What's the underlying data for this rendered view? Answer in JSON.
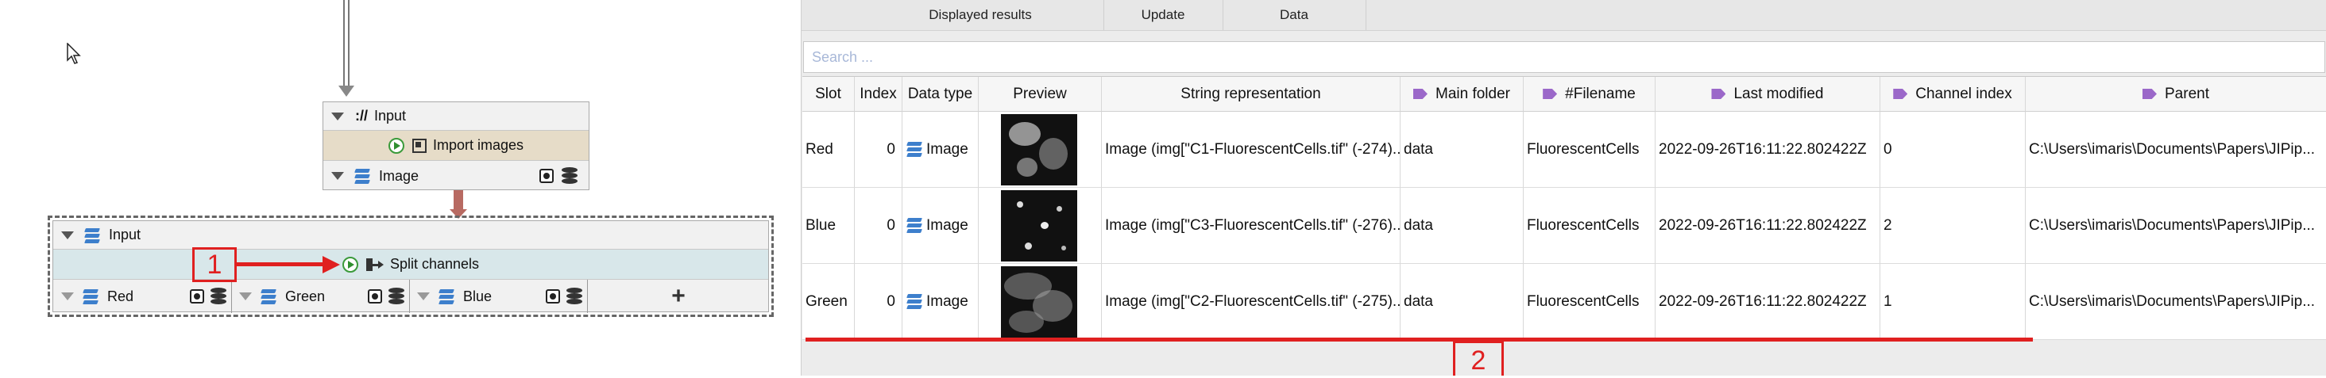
{
  "graph": {
    "input_node": {
      "header_label": "Input",
      "header_icon": "url-icon",
      "header_glyph": "://",
      "algorithm_label": "Import images",
      "output_label": "Image"
    },
    "split_node": {
      "header_label": "Input",
      "algorithm_label": "Split channels",
      "outputs": [
        {
          "label": "Red"
        },
        {
          "label": "Green"
        },
        {
          "label": "Blue"
        }
      ],
      "add_symbol": "+"
    },
    "annotation_1": "1",
    "annotation_2": "2",
    "annotation_color": "#e02020"
  },
  "panel": {
    "tabs": [
      "Displayed results",
      "Update",
      "Data"
    ],
    "search_placeholder": "Search ...",
    "columns": [
      "Slot",
      "Index",
      "Data type",
      "Preview",
      "String representation",
      "Main folder",
      "#Filename",
      "Last modified",
      "Channel index",
      "Parent"
    ],
    "rows": [
      {
        "slot": "Red",
        "index": "0",
        "data_type": "Image",
        "string_repr": "Image (img[\"C1-FluorescentCells.tif\" (-274)...",
        "main_folder": "data",
        "filename": "FluorescentCells",
        "last_modified": "2022-09-26T16:11:22.802422Z",
        "channel_index": "0",
        "parent": "C:\\Users\\imaris\\Documents\\Papers\\JIPip..."
      },
      {
        "slot": "Blue",
        "index": "0",
        "data_type": "Image",
        "string_repr": "Image (img[\"C3-FluorescentCells.tif\" (-276)...",
        "main_folder": "data",
        "filename": "FluorescentCells",
        "last_modified": "2022-09-26T16:11:22.802422Z",
        "channel_index": "2",
        "parent": "C:\\Users\\imaris\\Documents\\Papers\\JIPip..."
      },
      {
        "slot": "Green",
        "index": "0",
        "data_type": "Image",
        "string_repr": "Image (img[\"C2-FluorescentCells.tif\" (-275)...",
        "main_folder": "data",
        "filename": "FluorescentCells",
        "last_modified": "2022-09-26T16:11:22.802422Z",
        "channel_index": "1",
        "parent": "C:\\Users\\imaris\\Documents\\Papers\\JIPip..."
      }
    ],
    "annotation_tag_color": "#9b68c9"
  }
}
